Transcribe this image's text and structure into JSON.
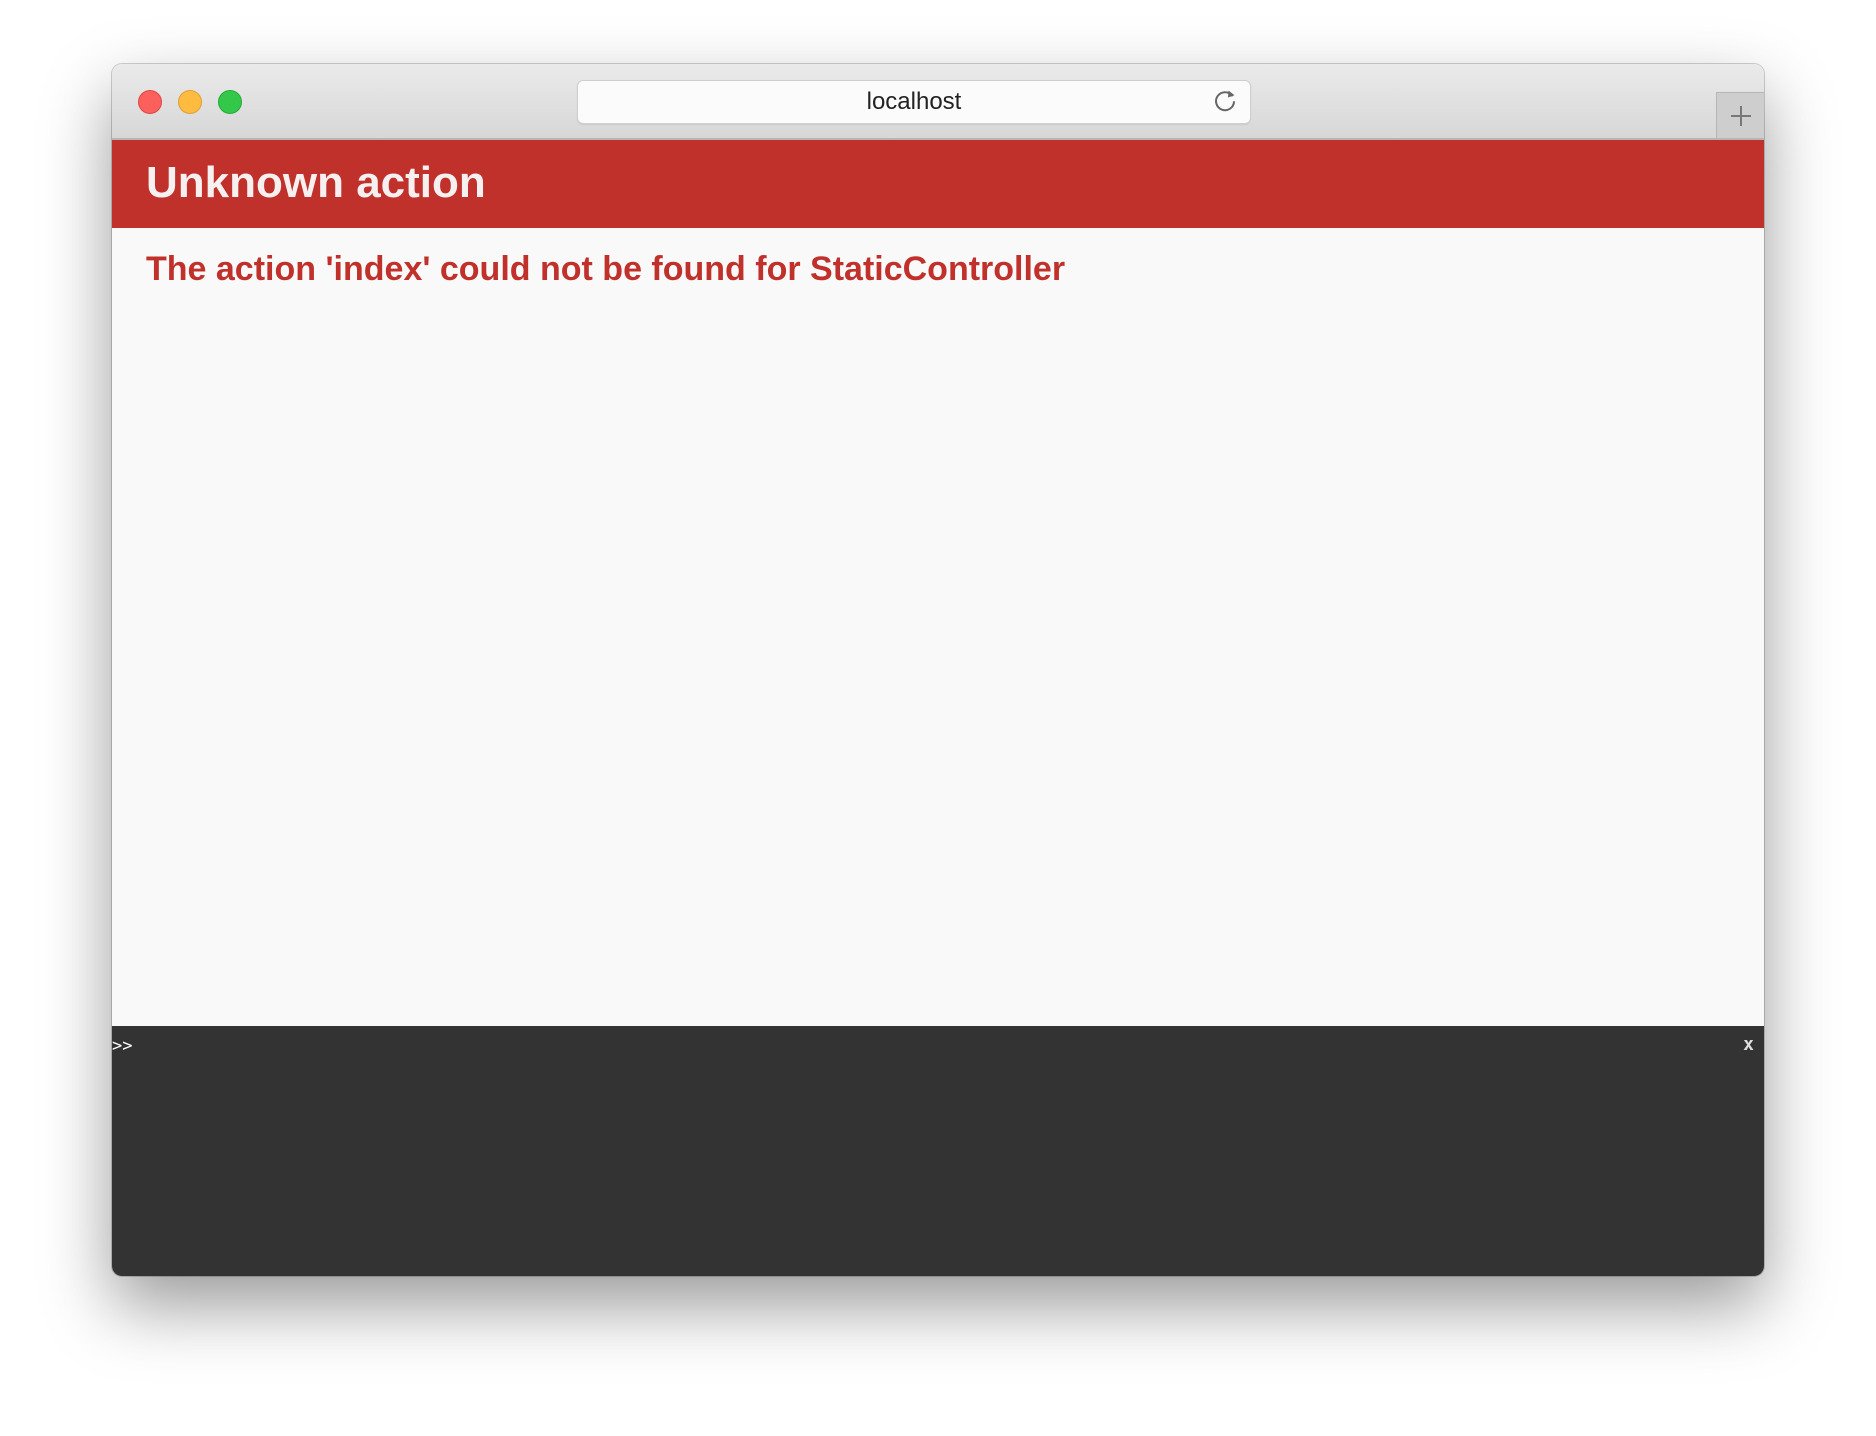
{
  "browser": {
    "address": "localhost",
    "icons": {
      "close": "close-window-icon",
      "minimize": "minimize-window-icon",
      "zoom": "zoom-window-icon",
      "reload": "reload-icon",
      "new_tab": "plus-icon"
    }
  },
  "page": {
    "title": "Unknown action",
    "message": "The action 'index' could not be found for StaticController"
  },
  "console": {
    "prompt": ">>",
    "close_label": "x"
  },
  "colors": {
    "error_red": "#c1312b",
    "console_bg": "#333333",
    "page_bg": "#f9f9f9"
  }
}
